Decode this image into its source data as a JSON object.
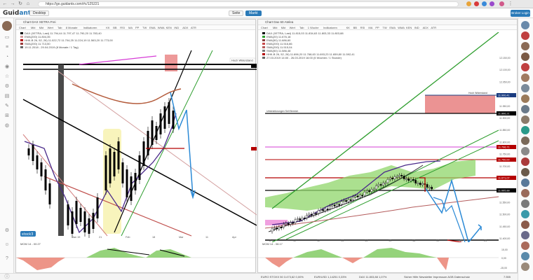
{
  "browser": {
    "url": "https://go.guidants.com/#c/125221",
    "nav": [
      "←",
      "→",
      "↻",
      "⌂"
    ]
  },
  "app": {
    "logo_main": "Guid",
    "logo_accent": "ants",
    "tabs": [
      {
        "label": "Desktop",
        "active": false
      },
      {
        "label": "Seite",
        "active": false
      },
      {
        "label": "Markt",
        "active": true
      }
    ],
    "broker_button": "Broker Login"
  },
  "left_chart": {
    "title": "Chart DAX XETRA Frei",
    "toolbar": [
      "Chart",
      "Mkt",
      "Mkt",
      "Wert",
      "Tab",
      "8 Monate",
      "Indikatoren",
      "KK",
      "BB",
      "RSI",
      "MA",
      "PP",
      "TW",
      "EMA",
      "WMA",
      "KEN",
      "IND",
      "ADX",
      "ATR"
    ],
    "legend": [
      {
        "text": "DAX (XETRA, Last)  11.794,44  11.797,47  11.790,20  11.783,40",
        "color": "#000000"
      },
      {
        "text": "EMA(200)  11.804,35",
        "color": "#d4a0a0"
      },
      {
        "text": "HHK-B 26, 52, 26)  11.022,72  11.704,25  11.224,19  11.563,20  11.773,00",
        "color": "#b40000"
      },
      {
        "text": "SMA(200)  11.713,50",
        "color": "#9a3b3b"
      },
      {
        "text": "19.11.2018 - 29.04.2019 (8 Monate / 1 Tag)",
        "color": "#666666"
      }
    ],
    "price_labels": [
      "Hoch Widerstand",
      "Unterstützung"
    ],
    "x_labels": [
      "Jan 19",
      "21",
      "Feb",
      "18",
      "Mar",
      "11",
      "Apr"
    ],
    "indicator_label": "MOM 14 - 00:27",
    "watermark": "stock3"
  },
  "right_chart": {
    "title": "Chart Dax 60 Atelea",
    "toolbar": [
      "Chart",
      "Mkt",
      "Mkt",
      "Wert",
      "Tab",
      "1 Woche",
      "Indikatoren",
      "KK",
      "BB",
      "RSI",
      "MA",
      "PP",
      "TW",
      "EMA",
      "WMA",
      "KEN",
      "IND",
      "ADX",
      "ATR"
    ],
    "legend": [
      {
        "text": "DAX (XETRA, Last)  11.815,03  11.834,63  11.803,33  11.803,88",
        "color": "#000000"
      },
      {
        "text": "EMA(20)  11.676,18",
        "color": "#2f9e2f"
      },
      {
        "text": "EMA(50)  11.686,60",
        "color": "#8a3f3f"
      },
      {
        "text": "EMA(200)  11.516,86",
        "color": "#c84a4a"
      },
      {
        "text": "SMA(200)  11.515,04",
        "color": "#b45c5c"
      },
      {
        "text": "SMA(50)  11.586,48",
        "color": "#7a7a7a"
      },
      {
        "text": "HHK-B 26, 52, 26)  11.696,20  11.768,63  11.693,23  11.659,80  11.592,41",
        "color": "#b40000"
      },
      {
        "text": "27.03.2019 14:00 - 26.03.2019 16:00 (5 Wochen / 1 Stunde)",
        "color": "#666666"
      }
    ],
    "zone_labels": [
      "Unterstützungen Sell Bereich",
      "Hoch Widerstand"
    ],
    "price_tags": [
      {
        "text": "11.900,41",
        "color": "#1a3c80"
      },
      {
        "text": "11.866,21",
        "color": "#000000"
      },
      {
        "text": "11.796,71",
        "color": "#b40000"
      },
      {
        "text": "11.750,00",
        "color": "#b40000"
      },
      {
        "text": "11.671,07",
        "color": "#b40000"
      },
      {
        "text": "11.665,88",
        "color": "#000000"
      }
    ],
    "axis_labels": [
      "12.150,00",
      "12.100,00",
      "12.050,00",
      "12.000,00",
      "11.950,00",
      "11.900,00",
      "11.850,00",
      "11.800,00",
      "11.750,00",
      "11.700,00",
      "11.650,00",
      "11.600,00",
      "11.550,00",
      "11.500,00",
      "11.450,00",
      "11.400,00"
    ],
    "x_labels": [
      "8",
      "11",
      "12",
      "13",
      "14",
      "15",
      "18",
      "19",
      "22",
      "25"
    ],
    "indicator_label": "MOM 14 - 06:17",
    "indicator_axis": [
      "15,00",
      "0,00",
      "-15,00"
    ]
  },
  "status_bar": {
    "items": [
      "EURO STOXX 50  3.473,62  0,00%",
      "EUR/USD  1,14251  0,33%",
      "DAX  11.803,88  1,07%",
      "Sicher  Hilfe  Newsletter  Impressum  AGB  Datenschutz",
      "7.555"
    ]
  },
  "colors": {
    "accent": "#2a7ab8",
    "candle": "#000000",
    "ema_green": "#2f9e2f",
    "resistance_zone": "#e88080",
    "support_red": "#b40000",
    "cloud": "#8fd66a",
    "forecast_blue": "#2c8ad6",
    "magenta": "#d63cd6"
  }
}
